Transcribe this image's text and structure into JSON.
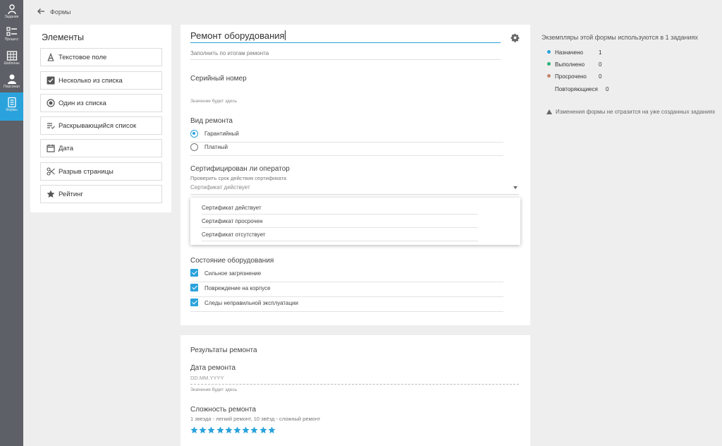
{
  "nav": {
    "items": [
      {
        "label": "Задания",
        "icon": "tasks-icon"
      },
      {
        "label": "Процесс",
        "icon": "process-icon"
      },
      {
        "label": "Шаблоны",
        "icon": "templates-icon"
      },
      {
        "label": "Персонал",
        "icon": "staff-icon"
      },
      {
        "label": "Формы",
        "icon": "forms-icon",
        "active": true
      }
    ]
  },
  "header": {
    "breadcrumb": "Формы"
  },
  "elements": {
    "title": "Элементы",
    "items": [
      {
        "label": "Текстовое поле",
        "icon": "text-field-icon"
      },
      {
        "label": "Несколько из списка",
        "icon": "checkbox-icon"
      },
      {
        "label": "Один из списка",
        "icon": "radio-icon"
      },
      {
        "label": "Раскрывающийся список",
        "icon": "dropdown-list-icon"
      },
      {
        "label": "Дата",
        "icon": "calendar-icon"
      },
      {
        "label": "Разрыв страницы",
        "icon": "scissors-icon"
      },
      {
        "label": "Рейтинг",
        "icon": "star-icon"
      }
    ]
  },
  "form": {
    "title": "Ремонт оборудования",
    "description": "Заполнить по итогам ремонта",
    "serial": {
      "label": "Серийный номер",
      "hint": "Значение будет здесь"
    },
    "repair_type": {
      "label": "Вид ремонта",
      "options": [
        "Гарантийный",
        "Платный"
      ],
      "selected": 0
    },
    "certified": {
      "label": "Сертифицирован ли оператор",
      "sublabel": "Проверить срок действия сертификата",
      "value": "Сертификат действует",
      "options": [
        "Сертификат действует",
        "Сертификат просрочен",
        "Сертификат отсутствует"
      ]
    },
    "condition": {
      "label": "Состояние оборудования",
      "options": [
        "Сильное загрязнение",
        "Повреждение на корпусе",
        "Следы неправильной эксплуатации"
      ]
    }
  },
  "form2": {
    "section_title": "Результаты ремонта",
    "date": {
      "label": "Дата ремонта",
      "placeholder": "DD.MM.YYYY",
      "hint": "Значение будет здесь"
    },
    "difficulty": {
      "label": "Сложность ремонта",
      "sublabel": "1 звезда - легкий ремонт, 10 звёзд - сложный ремонт",
      "stars": 10
    }
  },
  "info": {
    "title": "Экземпляры этой формы используются в 1 заданиях",
    "stats": [
      {
        "name": "Назначено",
        "value": "1",
        "color": "#2aa3dc"
      },
      {
        "name": "Выполнено",
        "value": "0",
        "color": "#2db37a"
      },
      {
        "name": "Просрочено",
        "value": "0",
        "color": "#c4866a"
      },
      {
        "name": "Повторяющиеся",
        "value": "0",
        "color": ""
      }
    ],
    "warning": "Изменения формы не отразится на уже созданных заданиях"
  },
  "colors": {
    "accent": "#2aa3dc",
    "nav_bg": "#5d6066"
  }
}
